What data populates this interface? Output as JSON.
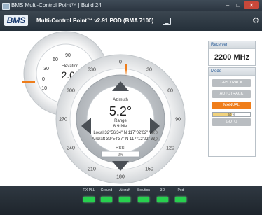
{
  "window": {
    "title": "BMS Multi-Control Point™ | Build 24",
    "min": "–",
    "max": "□",
    "close": "✕"
  },
  "header": {
    "logo": "BMS",
    "title": "Multi-Control Point™  v2.91  POD  (BMA 7100)"
  },
  "elevation": {
    "label": "Elevation",
    "value": "2.0°",
    "ticks": [
      "90",
      "60",
      "30",
      "0",
      "-10"
    ]
  },
  "azimuth": {
    "label": "Azimuth",
    "value": "5.2°",
    "range_label": "Range",
    "range_value": "8.9 NM",
    "local": "Local  32°56'34\" N  117°02'02\" W",
    "aircraft": "Aircraft  32°54'37\" N  117°12'22\" W",
    "rssi_label": "RSSI",
    "rssi_value": "2%",
    "ticks": [
      "0",
      "30",
      "60",
      "90",
      "120",
      "150",
      "180",
      "210",
      "240",
      "270",
      "300",
      "330"
    ]
  },
  "receiver": {
    "title": "Receiver",
    "frequency": "2200 MHz"
  },
  "mode": {
    "title": "Mode",
    "buttons": [
      "GPS TRACK",
      "AUTOTRACK",
      "MANUAL",
      "GOTO"
    ],
    "progress_text": "50 %",
    "progress_value": 0.5
  },
  "status": {
    "labels": [
      "RX PLL",
      "Ground",
      "Aircraft",
      "Solution",
      "3D",
      "Pod"
    ]
  },
  "colors": {
    "accent": "#ef7d1a",
    "ok": "#27d04e",
    "header": "#2b3540"
  }
}
